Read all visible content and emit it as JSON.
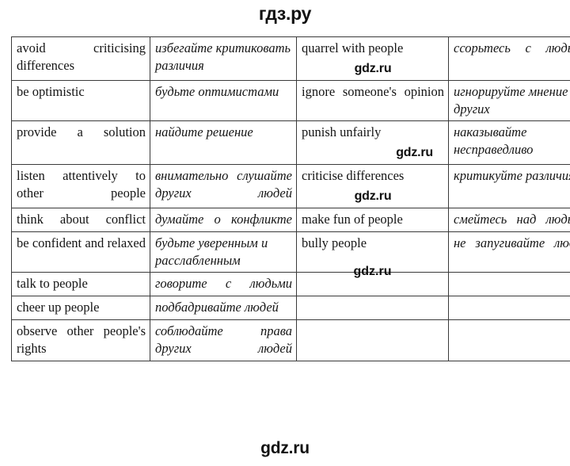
{
  "header": {
    "site_title": "гдз.ру"
  },
  "footer": {
    "watermark": "gdz.ru"
  },
  "watermarks": {
    "cell_r1": "gdz.ru",
    "cell_r3": "gdz.ru",
    "cell_r4": "gdz.ru",
    "cell_r6": "gdz.ru"
  },
  "table": {
    "left_rows": [
      {
        "en": "avoid criticising differences",
        "ru": "избегайте критиковать различия"
      },
      {
        "en": "be optimistic",
        "ru": "будьте оптимистами"
      },
      {
        "en": "provide a solution",
        "ru": "найдите решение"
      },
      {
        "en": "listen attentively to other people",
        "ru": "внимательно слушайте других людей"
      },
      {
        "en": "think about conflict",
        "ru": "думайте о конфликте"
      },
      {
        "en": "be confident and relaxed",
        "ru": "будьте уверенным и расслабленным"
      },
      {
        "en": "talk to people",
        "ru": "говорите с людьми"
      },
      {
        "en": "cheer up people",
        "ru": "подбадривайте людей"
      },
      {
        "en": "observe other people's rights",
        "ru": "соблюдайте права других людей"
      }
    ],
    "right_rows": [
      {
        "en": "quarrel with people",
        "ru": "ссорьтесь с людьми"
      },
      {
        "en": "ignore someone's opinion",
        "ru": "игнорируйте мнение других"
      },
      {
        "en": "punish unfairly",
        "ru": "наказывайте несправедливо"
      },
      {
        "en": "criticise differences",
        "ru": "критикуйте различия"
      },
      {
        "en": "make fun of people",
        "ru": "смейтесь над людьми"
      },
      {
        "en": "bully people",
        "ru": "не запугивайте людей"
      },
      {
        "en": "",
        "ru": ""
      },
      {
        "en": "",
        "ru": ""
      },
      {
        "en": "",
        "ru": ""
      }
    ]
  }
}
